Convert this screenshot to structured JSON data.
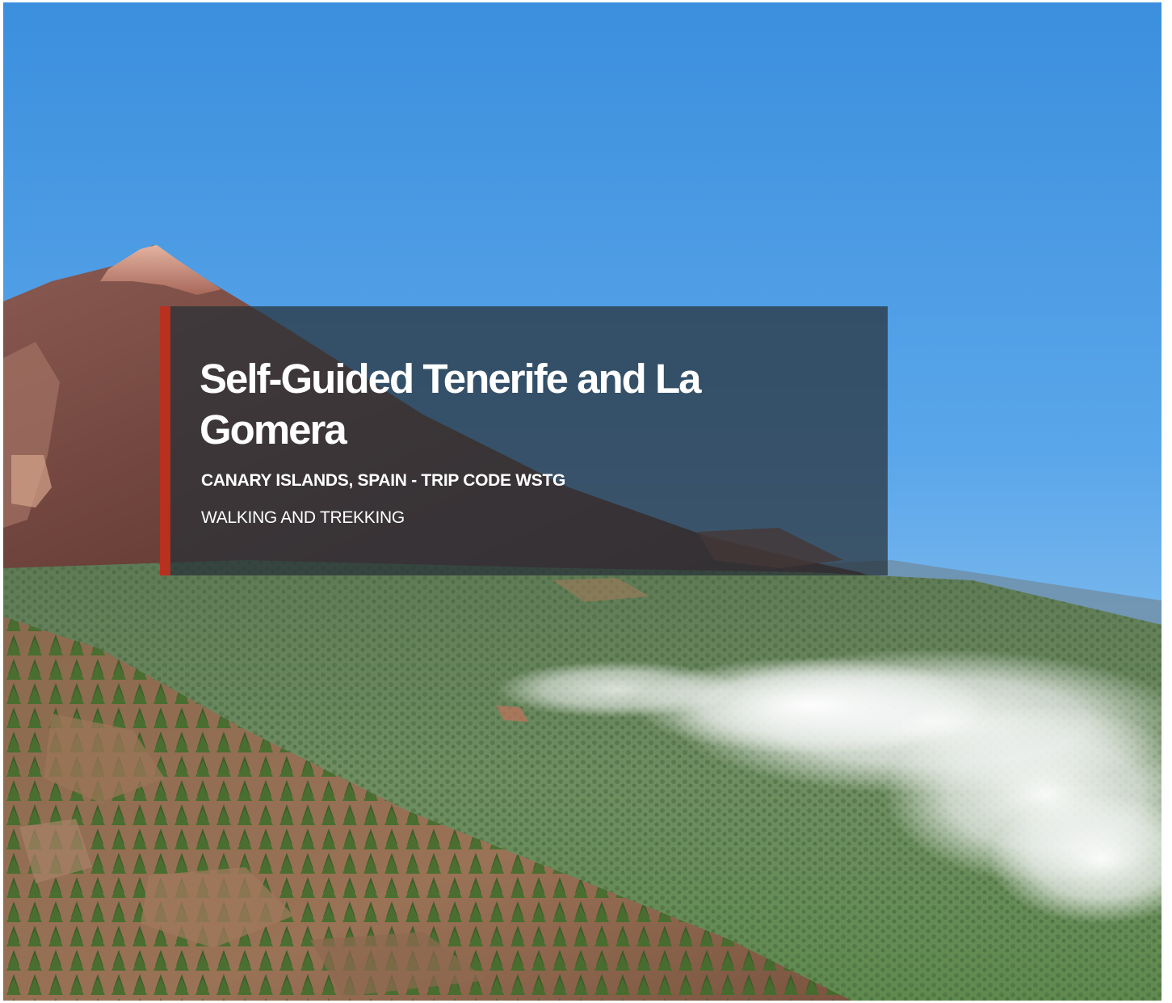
{
  "hero": {
    "image_alt": "Mount Teide volcano above pine forests and clouds on Tenerife"
  },
  "title_card": {
    "title": "Self-Guided Tenerife and La Gomera",
    "location": "CANARY ISLANDS, SPAIN - TRIP CODE WSTG",
    "activity": "WALKING AND TREKKING"
  },
  "colors": {
    "accent": "#b8301e",
    "card_background": "#283038",
    "text": "#ffffff",
    "sky": "#4a9be0"
  }
}
